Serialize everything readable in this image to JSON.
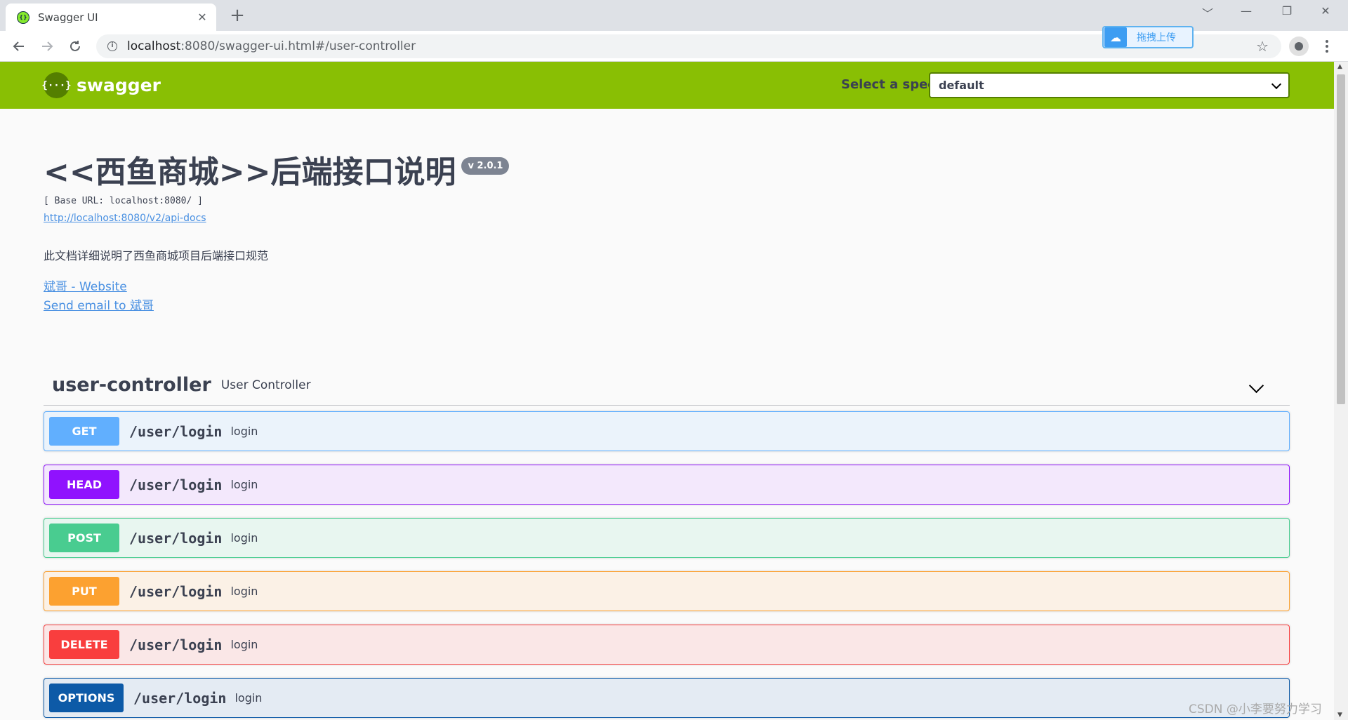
{
  "browser": {
    "tab_title": "Swagger UI",
    "tab_close": "✕",
    "new_tab": "+",
    "url_host": "localhost",
    "url_path": ":8080/swagger-ui.html#/user-controller",
    "extension_label": "拖拽上传",
    "window_controls": [
      "﹀",
      "—",
      "❐",
      "✕"
    ]
  },
  "swagger": {
    "logo_text": "swagger",
    "logo_glyph": "{···}",
    "select_spec_label": "Select a spec",
    "select_spec_value": "default"
  },
  "info": {
    "title": "<<西鱼商城>>后端接口说明",
    "version": "v 2.0.1",
    "base_url": "[ Base URL: localhost:8080/ ]",
    "api_docs_link": "http://localhost:8080/v2/api-docs",
    "description": "此文档详细说明了西鱼商城项目后端接口规范",
    "contact_website": "斌哥 - Website",
    "contact_email": "Send email to 斌哥"
  },
  "tag": {
    "name": "user-controller",
    "description": "User Controller"
  },
  "operations": [
    {
      "method": "GET",
      "path": "/user/login",
      "summary": "login",
      "color": "#61affe",
      "bg": "#ebf3fb",
      "border": "#61affe"
    },
    {
      "method": "HEAD",
      "path": "/user/login",
      "summary": "login",
      "color": "#9012fe",
      "bg": "#f3e8fc",
      "border": "#9012fe"
    },
    {
      "method": "POST",
      "path": "/user/login",
      "summary": "login",
      "color": "#49cc90",
      "bg": "#e8f6f0",
      "border": "#49cc90"
    },
    {
      "method": "PUT",
      "path": "/user/login",
      "summary": "login",
      "color": "#fca130",
      "bg": "#fbf1e6",
      "border": "#fca130"
    },
    {
      "method": "DELETE",
      "path": "/user/login",
      "summary": "login",
      "color": "#f93e3e",
      "bg": "#fae7e7",
      "border": "#f93e3e"
    },
    {
      "method": "OPTIONS",
      "path": "/user/login",
      "summary": "login",
      "color": "#0d5aa7",
      "bg": "#e4ebf3",
      "border": "#0d5aa7"
    }
  ],
  "watermark": "CSDN @小李要努力学习"
}
